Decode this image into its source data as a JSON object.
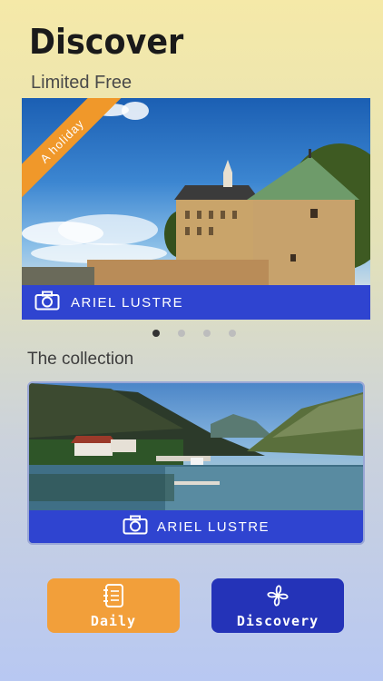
{
  "header": {
    "title": "Discover",
    "subtitle": "Limited Free"
  },
  "hero": {
    "ribbon": "A holiday",
    "caption": "ARIEL LUSTRE",
    "camera_icon": "camera-icon"
  },
  "pager": {
    "count": 4,
    "active_index": 0
  },
  "collection": {
    "heading": "The  collection",
    "caption": "ARIEL LUSTRE"
  },
  "bottom_nav": {
    "daily_label": "Daily",
    "daily_icon": "notebook-icon",
    "discovery_label": "Discovery",
    "discovery_icon": "pinwheel-icon"
  },
  "colors": {
    "accent_orange": "#f29f3a",
    "accent_blue": "#2433b8",
    "caption_blue": "#2f44d0"
  }
}
